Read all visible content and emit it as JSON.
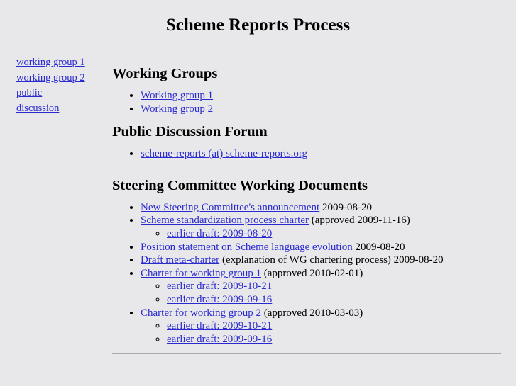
{
  "page": {
    "title": "Scheme Reports Process",
    "link_color": "#2a2ad0",
    "background_color": "#e8e8ea",
    "rule_color": "#a9a9ac"
  },
  "sidebar": {
    "items": [
      {
        "label": "working group 1"
      },
      {
        "label": "working group 2"
      },
      {
        "label": "public discussion"
      }
    ]
  },
  "main": {
    "sections": [
      {
        "heading": "Working Groups",
        "items": [
          {
            "link": "Working group 1",
            "note": ""
          },
          {
            "link": "Working group 2",
            "note": ""
          }
        ]
      },
      {
        "heading": "Public Discussion Forum",
        "items": [
          {
            "link": "scheme-reports (at) scheme-reports.org",
            "note": ""
          }
        ]
      },
      {
        "heading": "Steering Committee Working Documents",
        "items": [
          {
            "link": "New Steering Committee's announcement",
            "note": " 2009-08-20",
            "subitems": []
          },
          {
            "link": "Scheme standardization process charter",
            "note": " (approved 2009-11-16)",
            "subitems": [
              {
                "link": "earlier draft: 2009-08-20"
              }
            ]
          },
          {
            "link": "Position statement on Scheme language evolution",
            "note": " 2009-08-20",
            "subitems": []
          },
          {
            "link": "Draft meta-charter",
            "note": " (explanation of WG chartering process) 2009-08-20",
            "subitems": []
          },
          {
            "link": "Charter for working group 1",
            "note": " (approved 2010-02-01)",
            "subitems": [
              {
                "link": "earlier draft: 2009-10-21"
              },
              {
                "link": "earlier draft: 2009-09-16"
              }
            ]
          },
          {
            "link": "Charter for working group 2",
            "note": " (approved 2010-03-03)",
            "subitems": [
              {
                "link": "earlier draft: 2009-10-21"
              },
              {
                "link": "earlier draft: 2009-09-16"
              }
            ]
          }
        ]
      }
    ]
  }
}
